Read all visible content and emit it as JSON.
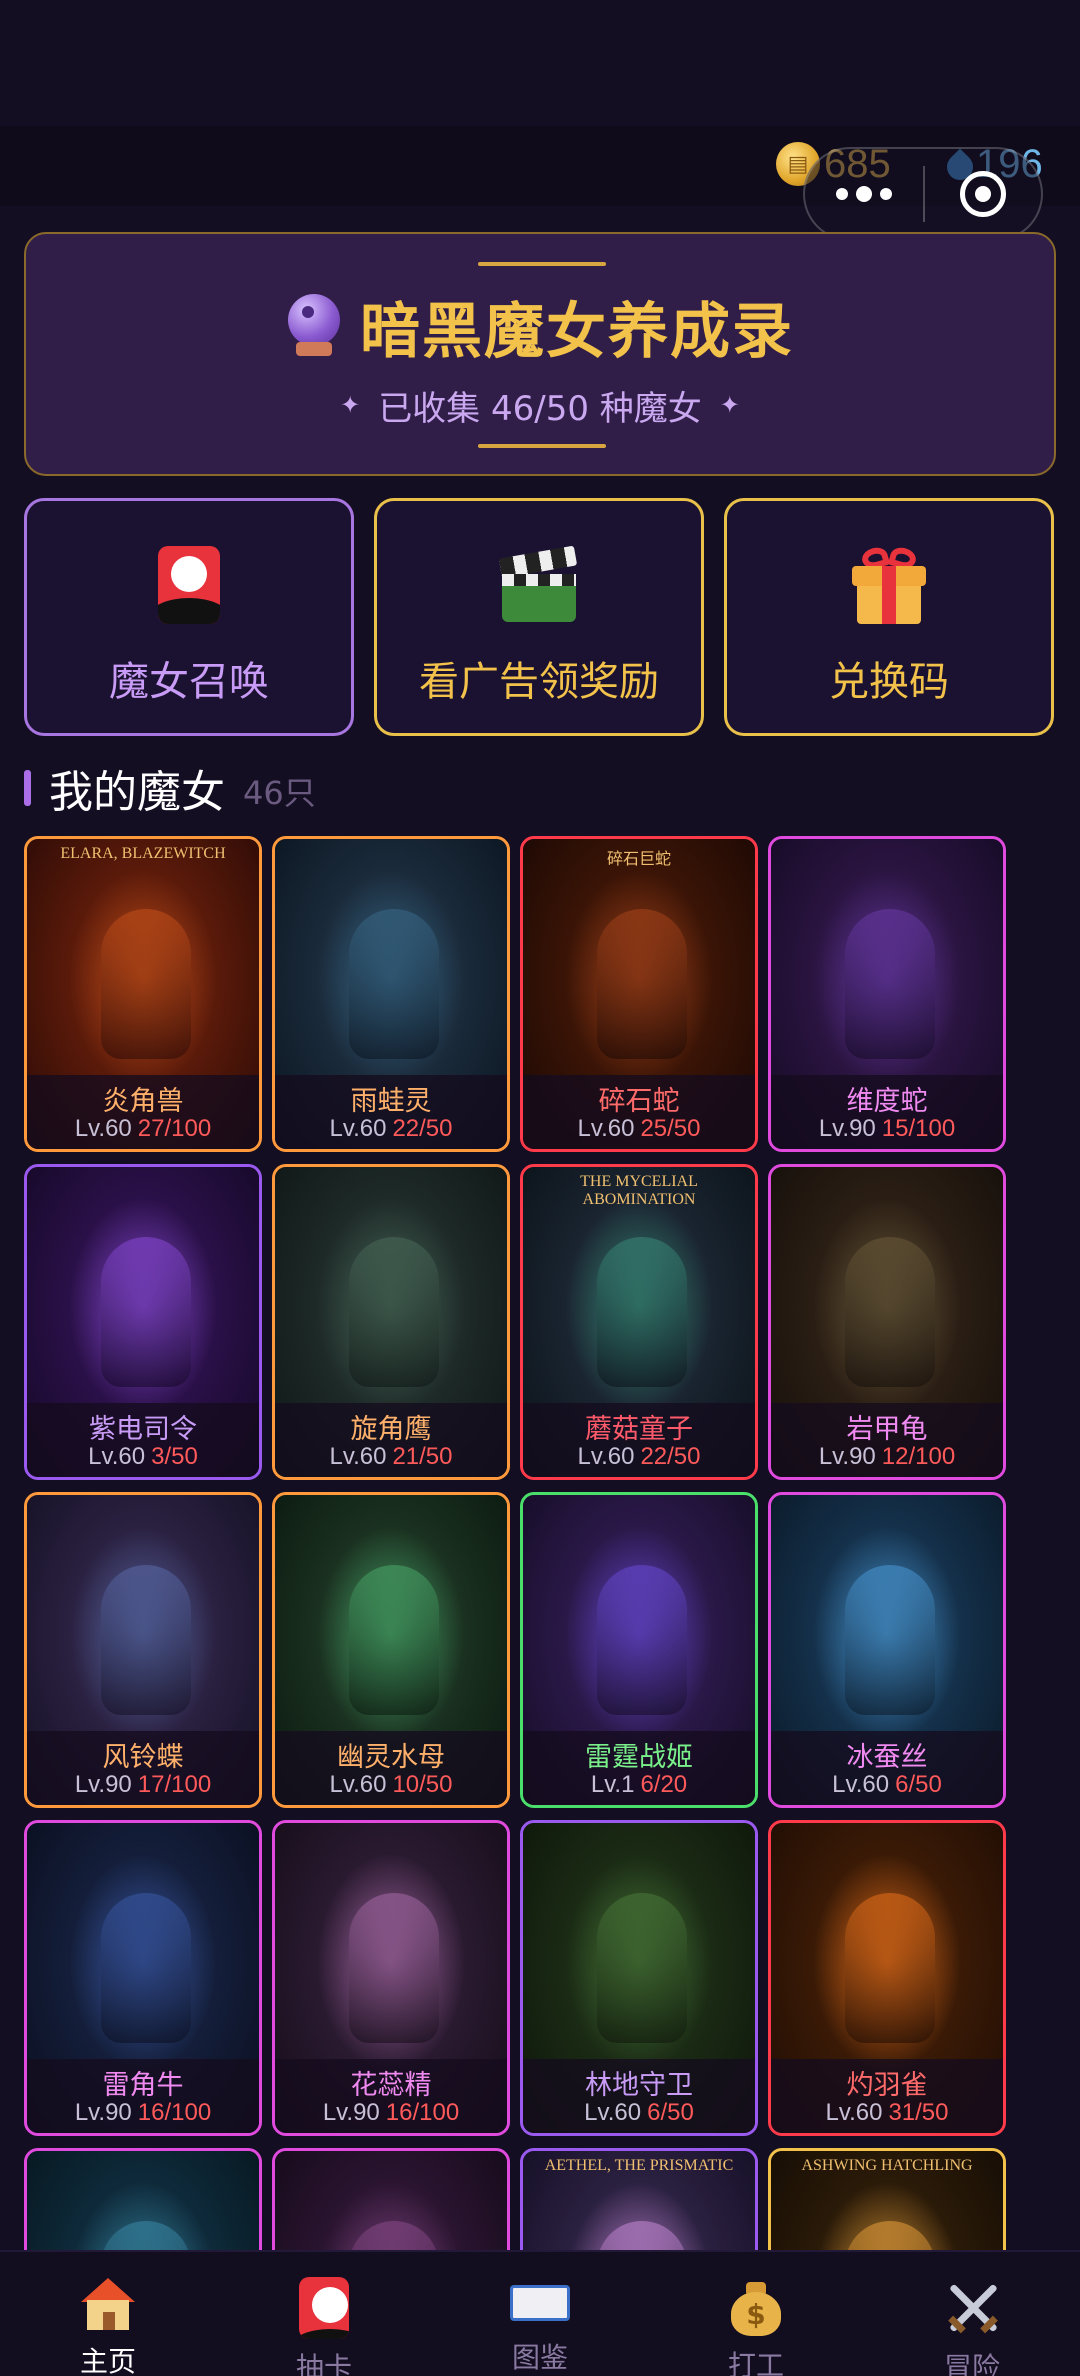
{
  "status_bar": {
    "coins": "685",
    "gems": "196"
  },
  "header": {
    "title": "暗黑魔女养成录",
    "subtitle": "已收集 46/50 种魔女",
    "sparkle": "✦"
  },
  "actions": [
    {
      "label": "魔女召唤",
      "icon": "summon-card-icon"
    },
    {
      "label": "看广告领奖励",
      "icon": "clapperboard-icon"
    },
    {
      "label": "兑换码",
      "icon": "gift-icon"
    }
  ],
  "section": {
    "title": "我的魔女",
    "count": "46只"
  },
  "cards": [
    {
      "name": "炎角兽",
      "level": "Lv.60",
      "progress": "27/100",
      "tag": "ELARA, BLAZEWITCH",
      "border": "#ff9a3c",
      "name_color": "#ffb06a"
    },
    {
      "name": "雨蛙灵",
      "level": "Lv.60",
      "progress": "22/50",
      "tag": "",
      "border": "#ff9a3c",
      "name_color": "#ffb06a"
    },
    {
      "name": "碎石蛇",
      "level": "Lv.60",
      "progress": "25/50",
      "tag": "碎石巨蛇",
      "border": "#ff3a4a",
      "name_color": "#ff6a6a"
    },
    {
      "name": "维度蛇",
      "level": "Lv.90",
      "progress": "15/100",
      "tag": "",
      "border": "#e04adf",
      "name_color": "#f08af0"
    },
    {
      "name": "紫电司令",
      "level": "Lv.60",
      "progress": "3/50",
      "tag": "",
      "border": "#9a5af0",
      "name_color": "#c89cf6"
    },
    {
      "name": "旋角鹰",
      "level": "Lv.60",
      "progress": "21/50",
      "tag": "",
      "border": "#ff9a3c",
      "name_color": "#ffb06a"
    },
    {
      "name": "蘑菇童子",
      "level": "Lv.60",
      "progress": "22/50",
      "tag": "THE MYCELIAL ABOMINATION",
      "border": "#ff3a4a",
      "name_color": "#ff5a6a"
    },
    {
      "name": "岩甲龟",
      "level": "Lv.90",
      "progress": "12/100",
      "tag": "",
      "border": "#e04adf",
      "name_color": "#f08af0"
    },
    {
      "name": "风铃蝶",
      "level": "Lv.90",
      "progress": "17/100",
      "tag": "",
      "border": "#ff9a3c",
      "name_color": "#ffb06a"
    },
    {
      "name": "幽灵水母",
      "level": "Lv.60",
      "progress": "10/50",
      "tag": "",
      "border": "#ff9a3c",
      "name_color": "#ffb06a"
    },
    {
      "name": "雷霆战姬",
      "level": "Lv.1",
      "progress": "6/20",
      "tag": "",
      "border": "#4ade6a",
      "name_color": "#7af08a"
    },
    {
      "name": "冰蚕丝",
      "level": "Lv.60",
      "progress": "6/50",
      "tag": "",
      "border": "#e04adf",
      "name_color": "#f08af0"
    },
    {
      "name": "雷角牛",
      "level": "Lv.90",
      "progress": "16/100",
      "tag": "",
      "border": "#e04adf",
      "name_color": "#f08af0"
    },
    {
      "name": "花蕊精",
      "level": "Lv.90",
      "progress": "16/100",
      "tag": "",
      "border": "#e04adf",
      "name_color": "#f08af0"
    },
    {
      "name": "林地守卫",
      "level": "Lv.60",
      "progress": "6/50",
      "tag": "",
      "border": "#9a5af0",
      "name_color": "#c89cf6"
    },
    {
      "name": "灼羽雀",
      "level": "Lv.60",
      "progress": "31/50",
      "tag": "",
      "border": "#ff3a4a",
      "name_color": "#ff6a6a"
    },
    {
      "name": "",
      "level": "",
      "progress": "",
      "tag": "",
      "border": "#e04adf",
      "name_color": "#f08af0"
    },
    {
      "name": "",
      "level": "",
      "progress": "",
      "tag": "",
      "border": "#e04adf",
      "name_color": "#f08af0"
    },
    {
      "name": "",
      "level": "",
      "progress": "",
      "tag": "AETHEL, THE PRISMATIC",
      "border": "#9a5af0",
      "name_color": "#c89cf6"
    },
    {
      "name": "",
      "level": "",
      "progress": "",
      "tag": "ASHWING HATCHLING",
      "border": "#f2c24a",
      "name_color": "#f2c24a"
    }
  ],
  "bottom_nav": [
    {
      "label": "主页",
      "icon": "house-icon",
      "active": true
    },
    {
      "label": "抽卡",
      "icon": "summon-card-icon",
      "active": false
    },
    {
      "label": "图鉴",
      "icon": "book-icon",
      "active": false
    },
    {
      "label": "打工",
      "icon": "money-bag-icon",
      "active": false
    },
    {
      "label": "冒险",
      "icon": "crossed-swords-icon",
      "active": false
    }
  ]
}
